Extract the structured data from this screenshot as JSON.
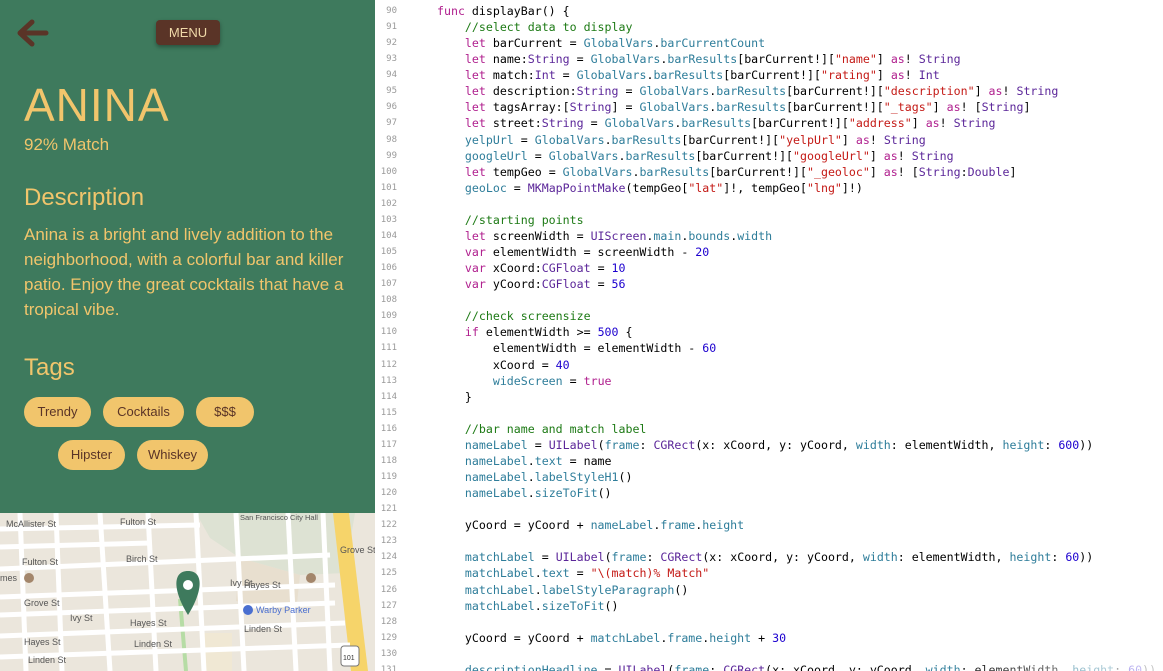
{
  "app": {
    "menu_label": "MENU",
    "bar_name": "ANINA",
    "match_text": "92% Match",
    "description_heading": "Description",
    "description": "Anina is a bright and lively addition to the neighborhood, with a colorful bar and killer patio. Enjoy the great cocktails that have a tropical vibe.",
    "tags_heading": "Tags",
    "tags": [
      "Trendy",
      "Cocktails",
      "$$$",
      "Hipster",
      "Whiskey"
    ]
  },
  "map": {
    "streets": [
      "McAllister St",
      "Fulton St",
      "Fulton St",
      "Birch St",
      "Grove St",
      "Ivy St",
      "Hayes St",
      "Hayes St",
      "Linden St",
      "Linden St",
      "Linden St",
      "Hayes St",
      "Ivy St",
      "Grove St",
      "San Francisco City Hall"
    ],
    "places": [
      "Warby Parker"
    ],
    "partial_label": "mes",
    "route_number": "101"
  },
  "code": {
    "lines": [
      {
        "n": "90",
        "t": "    func displayBar() {"
      },
      {
        "n": "91",
        "t": "        //select data to display"
      },
      {
        "n": "92",
        "t": "        let barCurrent = GlobalVars.barCurrentCount"
      },
      {
        "n": "93",
        "t": "        let name:String = GlobalVars.barResults[barCurrent!][\"name\"] as! String"
      },
      {
        "n": "94",
        "t": "        let match:Int = GlobalVars.barResults[barCurrent!][\"rating\"] as! Int"
      },
      {
        "n": "95",
        "t": "        let description:String = GlobalVars.barResults[barCurrent!][\"description\"] as! String"
      },
      {
        "n": "96",
        "t": "        let tagsArray:[String] = GlobalVars.barResults[barCurrent!][\"_tags\"] as! [String]"
      },
      {
        "n": "97",
        "t": "        let street:String = GlobalVars.barResults[barCurrent!][\"address\"] as! String"
      },
      {
        "n": "98",
        "t": "        yelpUrl = GlobalVars.barResults[barCurrent!][\"yelpUrl\"] as! String"
      },
      {
        "n": "99",
        "t": "        googleUrl = GlobalVars.barResults[barCurrent!][\"googleUrl\"] as! String"
      },
      {
        "n": "100",
        "t": "        let tempGeo = GlobalVars.barResults[barCurrent!][\"_geoloc\"] as! [String:Double]"
      },
      {
        "n": "101",
        "t": "        geoLoc = MKMapPointMake(tempGeo[\"lat\"]!, tempGeo[\"lng\"]!)"
      },
      {
        "n": "102",
        "t": ""
      },
      {
        "n": "103",
        "t": "        //starting points"
      },
      {
        "n": "104",
        "t": "        let screenWidth = UIScreen.main.bounds.width"
      },
      {
        "n": "105",
        "t": "        var elementWidth = screenWidth - 20"
      },
      {
        "n": "106",
        "t": "        var xCoord:CGFloat = 10"
      },
      {
        "n": "107",
        "t": "        var yCoord:CGFloat = 56"
      },
      {
        "n": "108",
        "t": ""
      },
      {
        "n": "109",
        "t": "        //check screensize"
      },
      {
        "n": "110",
        "t": "        if elementWidth >= 500 {"
      },
      {
        "n": "111",
        "t": "            elementWidth = elementWidth - 60"
      },
      {
        "n": "112",
        "t": "            xCoord = 40"
      },
      {
        "n": "113",
        "t": "            wideScreen = true"
      },
      {
        "n": "114",
        "t": "        }"
      },
      {
        "n": "115",
        "t": ""
      },
      {
        "n": "116",
        "t": "        //bar name and match label"
      },
      {
        "n": "117",
        "t": "        nameLabel = UILabel(frame: CGRect(x: xCoord, y: yCoord, width: elementWidth, height: 600))"
      },
      {
        "n": "118",
        "t": "        nameLabel.text = name"
      },
      {
        "n": "119",
        "t": "        nameLabel.labelStyleH1()"
      },
      {
        "n": "120",
        "t": "        nameLabel.sizeToFit()"
      },
      {
        "n": "121",
        "t": ""
      },
      {
        "n": "122",
        "t": "        yCoord = yCoord + nameLabel.frame.height"
      },
      {
        "n": "123",
        "t": ""
      },
      {
        "n": "124",
        "t": "        matchLabel = UILabel(frame: CGRect(x: xCoord, y: yCoord, width: elementWidth, height: 60))"
      },
      {
        "n": "125",
        "t": "        matchLabel.text = \"\\(match)% Match\""
      },
      {
        "n": "126",
        "t": "        matchLabel.labelStyleParagraph()"
      },
      {
        "n": "127",
        "t": "        matchLabel.sizeToFit()"
      },
      {
        "n": "128",
        "t": ""
      },
      {
        "n": "129",
        "t": "        yCoord = yCoord + matchLabel.frame.height + 30"
      },
      {
        "n": "130",
        "t": ""
      },
      {
        "n": "131",
        "t": "        descriptionHeadline = UILabel(frame: CGRect(x: xCoord, y: yCoord, width: elementWidth, height: 60))"
      }
    ]
  }
}
